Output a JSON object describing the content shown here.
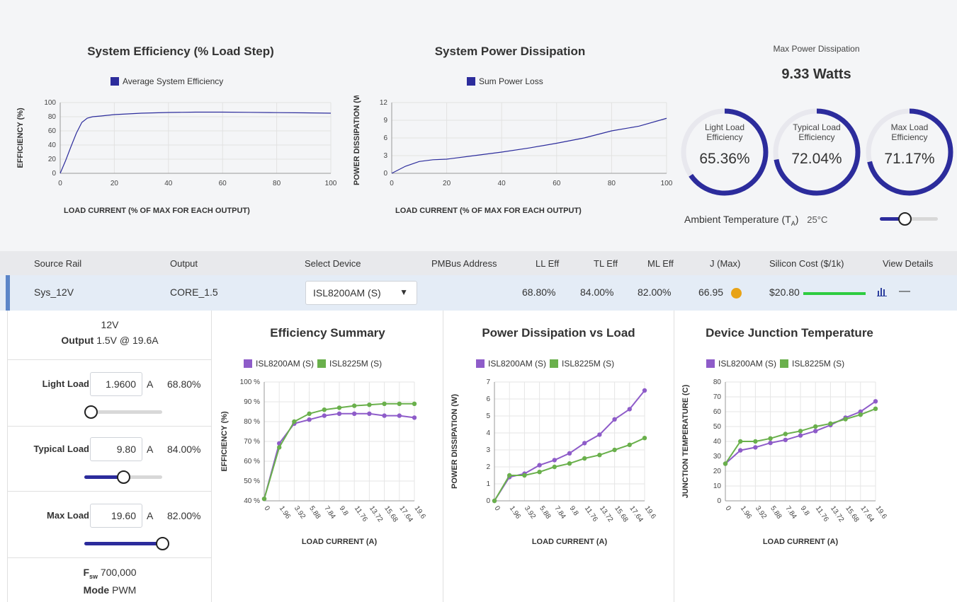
{
  "top": {
    "efficiency_chart": {
      "title": "System Efficiency (% Load Step)",
      "legend": "Average System Efficiency",
      "ylabel": "EFFICIENCY (%)",
      "xlabel": "LOAD CURRENT (% OF MAX FOR EACH OUTPUT)",
      "yticks": [
        "100",
        "80",
        "60",
        "40",
        "20",
        "0"
      ],
      "xticks": [
        "0",
        "20",
        "40",
        "60",
        "80",
        "100"
      ]
    },
    "dissipation_chart": {
      "title": "System Power Dissipation",
      "legend": "Sum Power Loss",
      "ylabel": "POWER DISSIPATION (W)",
      "xlabel": "LOAD CURRENT (% OF MAX FOR EACH OUTPUT)",
      "yticks": [
        "12",
        "9",
        "6",
        "3",
        "0"
      ],
      "xticks": [
        "0",
        "20",
        "40",
        "60",
        "80",
        "100"
      ]
    },
    "max_power_label": "Max Power Dissipation",
    "max_power_value": "9.33 Watts",
    "gauges": [
      {
        "label1": "Light Load",
        "label2": "Efficiency",
        "value": "65.36%",
        "fraction": 0.6536
      },
      {
        "label1": "Typical Load",
        "label2": "Efficiency",
        "value": "72.04%",
        "fraction": 0.7204
      },
      {
        "label1": "Max Load",
        "label2": "Efficiency",
        "value": "71.17%",
        "fraction": 0.7117
      }
    ],
    "ambient_label": "Ambient Temperature (T",
    "ambient_sub": "A",
    "ambient_close": ")",
    "ambient_value": "25°C"
  },
  "table": {
    "headers": [
      "Source Rail",
      "Output",
      "Select Device",
      "PMBus Address",
      "LL Eff",
      "TL Eff",
      "ML Eff",
      "J (Max)",
      "Silicon Cost ($/1k)",
      "View Details"
    ],
    "row": {
      "source_rail": "Sys_12V",
      "output": "CORE_1.5",
      "device": "ISL8200AM (S)",
      "ll_eff": "68.80%",
      "tl_eff": "84.00%",
      "ml_eff": "82.00%",
      "j_max": "66.95",
      "cost": "$20.80"
    }
  },
  "left_panel": {
    "vin": "12V",
    "output_label": "Output",
    "output_value": "1.5V @ 19.6A",
    "light_label": "Light Load",
    "light_value": "1.9600",
    "light_eff": "68.80%",
    "light_fraction": 0.1,
    "typical_label": "Typical Load",
    "typical_value": "9.80",
    "typical_eff": "84.00%",
    "typical_fraction": 0.5,
    "max_label": "Max Load",
    "max_value": "19.60",
    "max_eff": "82.00%",
    "max_fraction": 1.0,
    "unit": "A",
    "fsw_label": "F",
    "fsw_sub": "sw",
    "fsw_value": "700,000",
    "mode_label": "Mode",
    "mode_value": "PWM"
  },
  "bottom_charts": {
    "xticks": [
      "0",
      "1.96",
      "3.92",
      "5.88",
      "7.84",
      "9.8",
      "11.76",
      "13.72",
      "15.68",
      "17.64",
      "19.6"
    ],
    "xlabel": "LOAD CURRENT (A)",
    "legend1": "ISL8200AM (S)",
    "legend2": "ISL8225M (S)",
    "efficiency_title": "Efficiency Summary",
    "efficiency_ylabel": "EFFICIENCY (%)",
    "efficiency_yticks": [
      "100 %",
      "90 %",
      "80 %",
      "70 %",
      "60 %",
      "50 %",
      "40 %"
    ],
    "dissipation_title": "Power Dissipation vs Load",
    "dissipation_ylabel": "POWER DISSIPATION (W)",
    "dissipation_yticks": [
      "7",
      "6",
      "5",
      "4",
      "3",
      "2",
      "1",
      "0"
    ],
    "junction_title": "Device Junction Temperature",
    "junction_ylabel": "JUNCTION TEMPERATURE (C)",
    "junction_yticks": [
      "80",
      "70",
      "60",
      "50",
      "40",
      "30",
      "20",
      "10",
      "0"
    ]
  },
  "colors": {
    "navy": "#2c2c9c",
    "purple": "#8e5cc9",
    "green": "#6ab04c",
    "gauge_track": "#e8e8ee",
    "orange_dot": "#e8a317",
    "cost_bar": "#2ecc40"
  },
  "chart_data": [
    {
      "type": "line",
      "title": "System Efficiency (% Load Step)",
      "xlabel": "LOAD CURRENT (% OF MAX FOR EACH OUTPUT)",
      "ylabel": "EFFICIENCY (%)",
      "xlim": [
        0,
        100
      ],
      "ylim": [
        0,
        100
      ],
      "series": [
        {
          "name": "Average System Efficiency",
          "x": [
            0,
            2,
            4,
            6,
            8,
            10,
            12,
            15,
            20,
            30,
            40,
            50,
            60,
            70,
            80,
            90,
            100
          ],
          "y": [
            0,
            18,
            38,
            57,
            72,
            78,
            80,
            81,
            83,
            85,
            86,
            86.5,
            86.5,
            86.2,
            85.8,
            85.5,
            85
          ]
        }
      ]
    },
    {
      "type": "line",
      "title": "System Power Dissipation",
      "xlabel": "LOAD CURRENT (% OF MAX FOR EACH OUTPUT)",
      "ylabel": "POWER DISSIPATION (W)",
      "xlim": [
        0,
        100
      ],
      "ylim": [
        0,
        12
      ],
      "series": [
        {
          "name": "Sum Power Loss",
          "x": [
            0,
            5,
            10,
            15,
            20,
            30,
            40,
            50,
            60,
            70,
            80,
            90,
            100
          ],
          "y": [
            0,
            1.2,
            2.0,
            2.3,
            2.4,
            3.0,
            3.6,
            4.3,
            5.1,
            6.0,
            7.2,
            8.0,
            9.33
          ]
        }
      ]
    },
    {
      "type": "line",
      "title": "Efficiency Summary",
      "xlabel": "LOAD CURRENT (A)",
      "ylabel": "EFFICIENCY (%)",
      "ylim": [
        40,
        100
      ],
      "categories": [
        "0",
        "1.96",
        "3.92",
        "5.88",
        "7.84",
        "9.8",
        "11.76",
        "13.72",
        "15.68",
        "17.64",
        "19.6"
      ],
      "series": [
        {
          "name": "ISL8200AM (S)",
          "values": [
            41,
            69,
            79,
            81,
            83,
            84,
            84,
            84,
            83,
            83,
            82
          ]
        },
        {
          "name": "ISL8225M (S)",
          "values": [
            41,
            67,
            80,
            84,
            86,
            87,
            88,
            88.5,
            89,
            89,
            89
          ]
        }
      ]
    },
    {
      "type": "line",
      "title": "Power Dissipation vs Load",
      "xlabel": "LOAD CURRENT (A)",
      "ylabel": "POWER DISSIPATION (W)",
      "ylim": [
        0,
        7
      ],
      "categories": [
        "0",
        "1.96",
        "3.92",
        "5.88",
        "7.84",
        "9.8",
        "11.76",
        "13.72",
        "15.68",
        "17.64",
        "19.6"
      ],
      "series": [
        {
          "name": "ISL8200AM (S)",
          "values": [
            0,
            1.4,
            1.6,
            2.1,
            2.4,
            2.8,
            3.4,
            3.9,
            4.8,
            5.4,
            6.5
          ]
        },
        {
          "name": "ISL8225M (S)",
          "values": [
            0,
            1.5,
            1.5,
            1.7,
            2.0,
            2.2,
            2.5,
            2.7,
            3.0,
            3.3,
            3.7
          ]
        }
      ]
    },
    {
      "type": "line",
      "title": "Device Junction Temperature",
      "xlabel": "LOAD CURRENT (A)",
      "ylabel": "JUNCTION TEMPERATURE (C)",
      "ylim": [
        0,
        80
      ],
      "categories": [
        "0",
        "1.96",
        "3.92",
        "5.88",
        "7.84",
        "9.8",
        "11.76",
        "13.72",
        "15.68",
        "17.64",
        "19.6"
      ],
      "series": [
        {
          "name": "ISL8200AM (S)",
          "values": [
            25,
            34,
            36,
            39,
            41,
            44,
            47,
            51,
            56,
            60,
            67
          ]
        },
        {
          "name": "ISL8225M (S)",
          "values": [
            25,
            40,
            40,
            42,
            45,
            47,
            50,
            52,
            55,
            58,
            62
          ]
        }
      ]
    }
  ]
}
